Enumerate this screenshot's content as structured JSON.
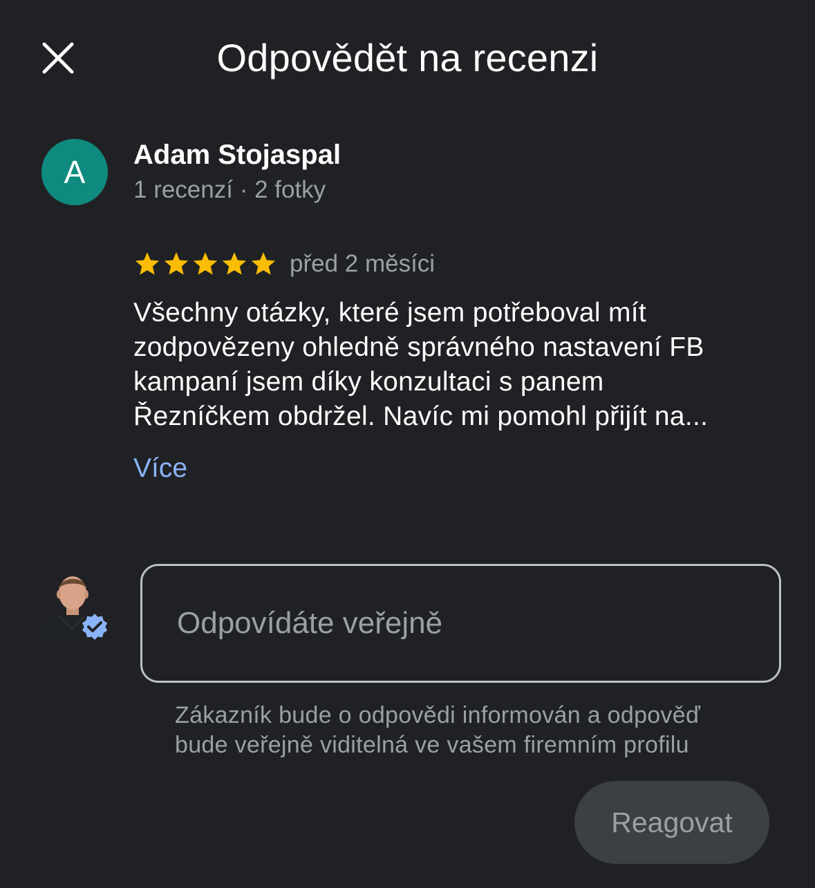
{
  "header": {
    "title": "Odpovědět na recenzi",
    "close_icon": "close-icon"
  },
  "review": {
    "avatar_letter": "A",
    "avatar_color": "#0f8a7e",
    "author": "Adam Stojaspal",
    "author_meta": "1 recenzí · 2 fotky",
    "rating": 5,
    "rating_max": 5,
    "star_color": "#fbbc04",
    "time_ago": "před 2 měsíci",
    "text_lines": [
      "Všechny otázky, které jsem potřeboval mít",
      "zodpovězeny ohledně správného nastavení FB",
      "kampaní jsem díky konzultaci s panem",
      "Řezníčkem obdržel. Navíc mi pomohl přijít na..."
    ],
    "more_label": "Více",
    "link_color": "#8ab4f8"
  },
  "reply": {
    "owner_avatar_icon": "owner-photo-avatar",
    "verified_badge_icon": "verified-badge-icon",
    "verified_color": "#8ab4f8",
    "placeholder": "Odpovídáte veřejně",
    "value": "",
    "helper_lines": [
      "Zákazník bude o odpovědi informován a odpověď",
      "bude veřejně viditelná ve vašem firemním profilu"
    ],
    "submit_label": "Reagovat"
  }
}
